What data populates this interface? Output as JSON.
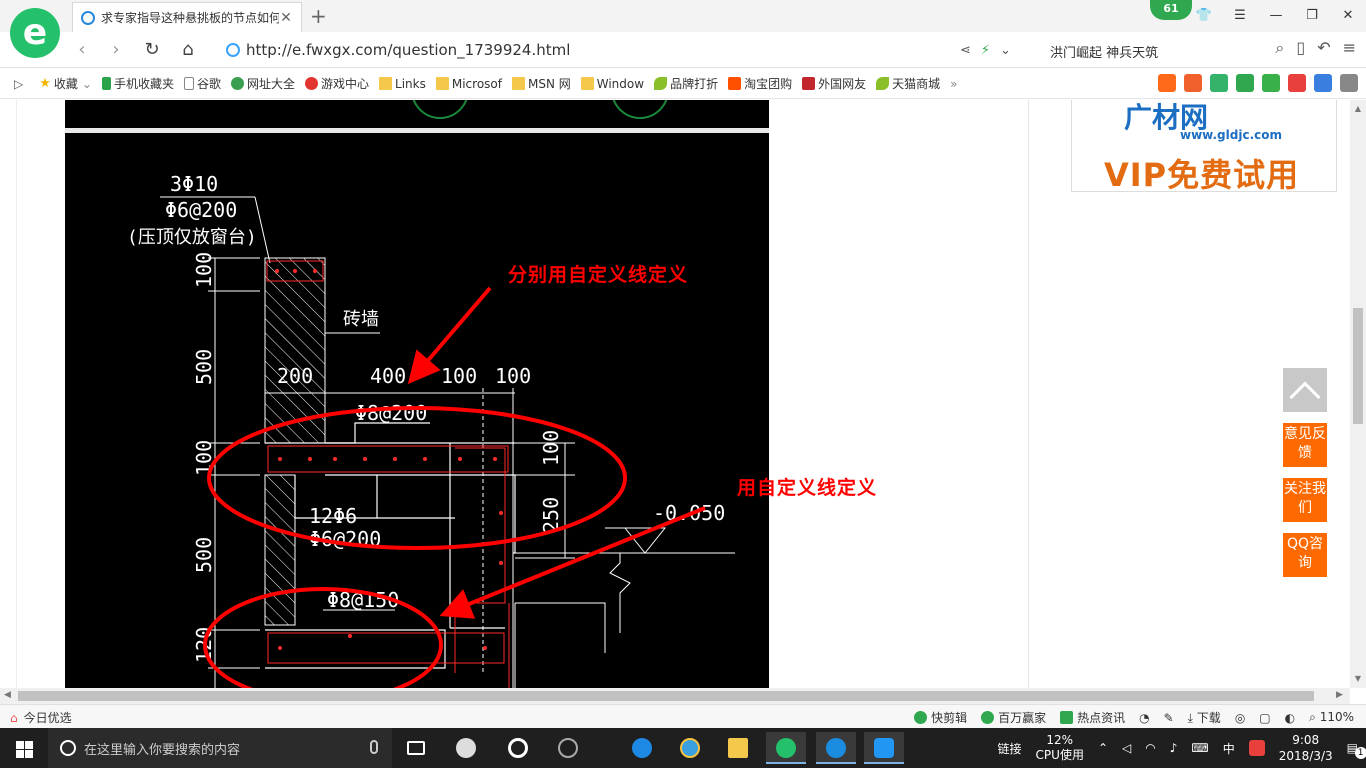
{
  "browser": {
    "tab_title": "求专家指导这种悬挑板的节点如何",
    "url": "http://e.fwxgx.com/question_1739924.html",
    "search_text": "洪门崛起 神兵天筑",
    "badge_count": "61"
  },
  "bookmarks": [
    {
      "label": "收藏",
      "icon": "star-icon"
    },
    {
      "label": "手机收藏夹",
      "icon": "phone-icon"
    },
    {
      "label": "谷歌",
      "icon": "doc-icon"
    },
    {
      "label": "网址大全",
      "icon": "globe-icon"
    },
    {
      "label": "游戏中心",
      "icon": "game-icon"
    },
    {
      "label": "Links",
      "icon": "folder-icon"
    },
    {
      "label": "Microsof",
      "icon": "folder-icon"
    },
    {
      "label": "MSN 网",
      "icon": "folder-icon"
    },
    {
      "label": "Window",
      "icon": "folder-icon"
    },
    {
      "label": "品牌打折",
      "icon": "leaf-icon"
    },
    {
      "label": "淘宝团购",
      "icon": "taobao-icon"
    },
    {
      "label": "外国网友",
      "icon": "red-icon"
    },
    {
      "label": "天猫商城",
      "icon": "leaf-icon"
    }
  ],
  "drawing": {
    "annotation_top": "分别用自定义线定义",
    "annotation_bottom": "用自定义线定义",
    "rebar_top": "3Φ10",
    "stirrup_top": "Φ6@200",
    "note_top": "(压顶仅放窗台)",
    "wall_label": "砖墙",
    "dim_200": "200",
    "dim_400": "400",
    "dim_100a": "100",
    "dim_100b": "100",
    "rebar_slab": "Φ8@200",
    "rebar_beam": "12Φ6",
    "stirrup_beam": "Φ6@200",
    "rebar_lower": "Φ8@150",
    "elevation": "-0.050",
    "vdim_100a": "100",
    "vdim_500a": "500",
    "vdim_100b": "100",
    "vdim_500b": "500",
    "vdim_120": "120",
    "vdim_r100": "100",
    "vdim_r250": "250"
  },
  "ad": {
    "brand": "广材网",
    "url": "www.gldjc.com",
    "promo": "VIP免费试用"
  },
  "float_buttons": [
    "意见反馈",
    "关注我们",
    "QQ咨询"
  ],
  "statusbar": {
    "left": "今日优选",
    "items": [
      "快剪辑",
      "百万赢家",
      "热点资讯",
      "下载",
      "110%"
    ]
  },
  "taskbar": {
    "search_placeholder": "在这里输入你要搜索的内容",
    "link_label": "链接",
    "cpu_percent": "12%",
    "cpu_label": "CPU使用",
    "ime": "中",
    "time": "9:08",
    "date": "2018/3/3",
    "notification_count": "1"
  }
}
